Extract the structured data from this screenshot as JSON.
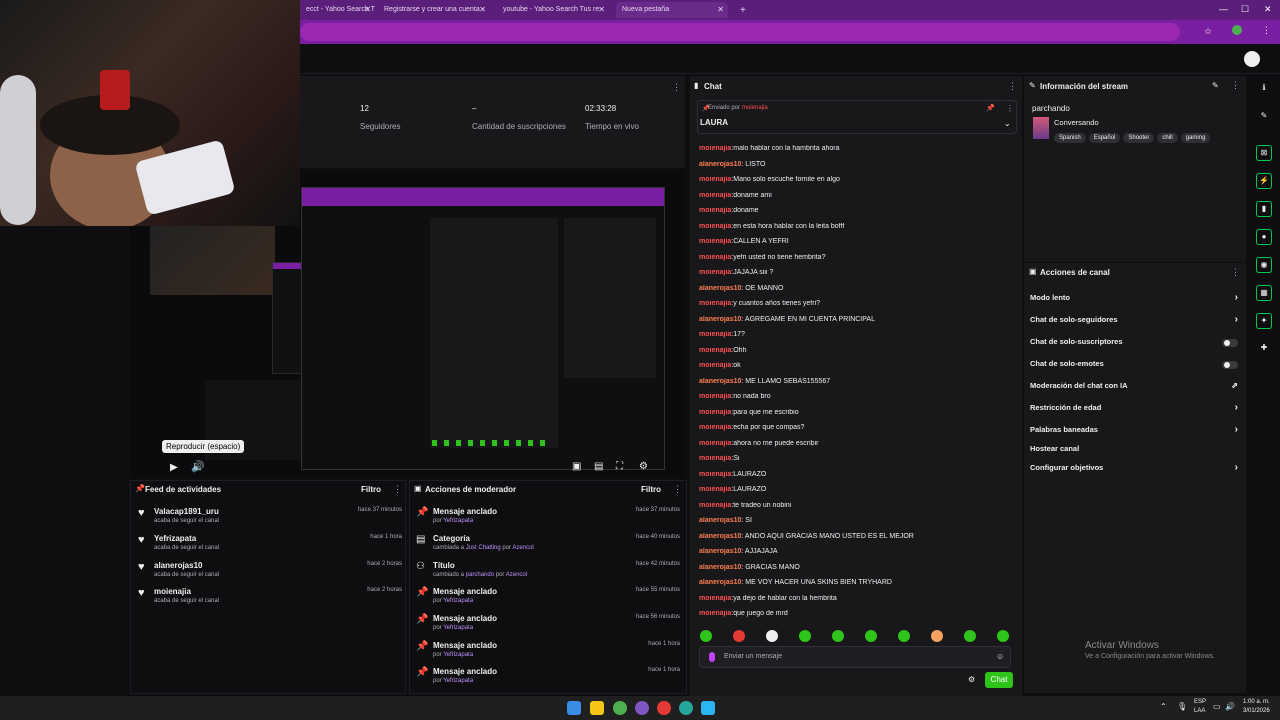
{
  "browser": {
    "tabs": [
      {
        "label": "ecct - Yahoo Search T"
      },
      {
        "label": "Registrarse y crear una cuenta"
      },
      {
        "label": "youtube - Yahoo Search Tus re"
      },
      {
        "label": "Nueva pestaña"
      }
    ],
    "new_tab": "+",
    "minimize": "—",
    "maximize": "☐",
    "close": "✕"
  },
  "stats": [
    {
      "value": "12",
      "label": "Seguidores"
    },
    {
      "value": "–",
      "label": "Cantidad de suscripciones"
    },
    {
      "value": "02:33:28",
      "label": "Tiempo en vivo"
    }
  ],
  "preview": {
    "tooltip": "Reproducir (espacio)"
  },
  "activity_feed": {
    "title": "Feed de actividades",
    "filter": "Filtro",
    "items": [
      {
        "name": "Valacap1891_uru",
        "sub": "acaba de seguir el canal",
        "time": "hace 37 minutos"
      },
      {
        "name": "Yefrizapata",
        "sub": "acaba de seguir el canal",
        "time": "hace 1 hora"
      },
      {
        "name": "alanerojas10",
        "sub": "acaba de seguir el canal",
        "time": "hace 2 horas"
      },
      {
        "name": "moienajia",
        "sub": "acaba de seguir el canal",
        "time": "hace 2 horas"
      }
    ]
  },
  "mod_actions": {
    "title": "Acciones de moderador",
    "filter": "Filtro",
    "items": [
      {
        "icon": "pin-icon",
        "name": "Mensaje anclado",
        "pre": "por ",
        "hl": "Yefrizapata",
        "mid": "",
        "hl2": "",
        "time": "hace 37 minutos"
      },
      {
        "icon": "category-icon",
        "name": "Categoría",
        "pre": "cambiada a ",
        "hl": "Just Chatting",
        "mid": " por ",
        "hl2": "Azencol",
        "time": "hace 40 minutos"
      },
      {
        "icon": "title-icon",
        "name": "Título",
        "pre": "cambiado a ",
        "hl": "parchando",
        "mid": " por ",
        "hl2": "Azencol",
        "time": "hace 42 minutos"
      },
      {
        "icon": "pin-icon",
        "name": "Mensaje anclado",
        "pre": "por ",
        "hl": "Yefrizapata",
        "mid": "",
        "hl2": "",
        "time": "hace 55 minutos"
      },
      {
        "icon": "pin-icon",
        "name": "Mensaje anclado",
        "pre": "por ",
        "hl": "Yefrizapata",
        "mid": "",
        "hl2": "",
        "time": "hace 56 minutos"
      },
      {
        "icon": "pin-icon",
        "name": "Mensaje anclado",
        "pre": "por ",
        "hl": "Yefrizapata",
        "mid": "",
        "hl2": "",
        "time": "hace 1 hora"
      },
      {
        "icon": "pin-icon",
        "name": "Mensaje anclado",
        "pre": "por ",
        "hl": "Yefrizapata",
        "mid": "",
        "hl2": "",
        "time": "hace 1 hora"
      }
    ]
  },
  "chat": {
    "title": "Chat",
    "pinned_by": "Enviado por",
    "pinned_user": "moienajia",
    "pinned_text": "LAURA",
    "messages": [
      {
        "user": "moienajia",
        "color": "#ff4f4f",
        "text": ":malo hablar con la hambrita ahora"
      },
      {
        "user": "alanerojas10",
        "color": "#ff7f50",
        "text": ": LISTO"
      },
      {
        "user": "moienajia",
        "color": "#ff4f4f",
        "text": ":Mano solo escuche fornite en algo"
      },
      {
        "user": "moienajia",
        "color": "#ff4f4f",
        "text": ":doname ami"
      },
      {
        "user": "moienajia",
        "color": "#ff4f4f",
        "text": ":doname"
      },
      {
        "user": "moienajia",
        "color": "#ff4f4f",
        "text": ":en esta hora hablar con la leita bofff"
      },
      {
        "user": "moienajia",
        "color": "#ff4f4f",
        "text": ":CALLEN A YEFRI"
      },
      {
        "user": "moienajia",
        "color": "#ff4f4f",
        "text": ":yefri usted no tiene hembrita?"
      },
      {
        "user": "moienajia",
        "color": "#ff4f4f",
        "text": ":JAJAJA siii ?"
      },
      {
        "user": "alanerojas10",
        "color": "#ff7f50",
        "text": ": OE MANNO"
      },
      {
        "user": "moienajia",
        "color": "#ff4f4f",
        "text": ":y cuantos años tienes yefri?"
      },
      {
        "user": "alanerojas10",
        "color": "#ff7f50",
        "text": ": AGREGAME EN MI CUENTA PRINCIPAL"
      },
      {
        "user": "moienajia",
        "color": "#ff4f4f",
        "text": ":17?"
      },
      {
        "user": "moienajia",
        "color": "#ff4f4f",
        "text": ":Ohh"
      },
      {
        "user": "moienajia",
        "color": "#ff4f4f",
        "text": ":ok"
      },
      {
        "user": "alanerojas10",
        "color": "#ff7f50",
        "text": ": ME LLAMO SEBAS155567"
      },
      {
        "user": "moienajia",
        "color": "#ff4f4f",
        "text": ":no nada bro"
      },
      {
        "user": "moienajia",
        "color": "#ff4f4f",
        "text": ":para que me escribio"
      },
      {
        "user": "moienajia",
        "color": "#ff4f4f",
        "text": ":echa por que compas?"
      },
      {
        "user": "moienajia",
        "color": "#ff4f4f",
        "text": ":ahora no me puede escribir"
      },
      {
        "user": "moienajia",
        "color": "#ff4f4f",
        "text": ":Si"
      },
      {
        "user": "moienajia",
        "color": "#ff4f4f",
        "text": ":LAURAZO"
      },
      {
        "user": "moienajia",
        "color": "#ff4f4f",
        "text": ":LAURAZO"
      },
      {
        "user": "moienajia",
        "color": "#ff4f4f",
        "text": ":te tradeo un nobini"
      },
      {
        "user": "alanerojas10",
        "color": "#ff7f50",
        "text": ": SI"
      },
      {
        "user": "alanerojas10",
        "color": "#ff7f50",
        "text": ": ANDO AQUI GRACIAS MANO USTED ES EL MEJOR"
      },
      {
        "user": "alanerojas10",
        "color": "#ff7f50",
        "text": ": AJJAJAJA"
      },
      {
        "user": "alanerojas10",
        "color": "#ff7f50",
        "text": ": GRACIAS MANO"
      },
      {
        "user": "alanerojas10",
        "color": "#ff7f50",
        "text": ": ME VOY HACER UNA SKINS BIEN TRYHARD"
      },
      {
        "user": "moienajia",
        "color": "#ff4f4f",
        "text": ":ya dejo de hablar con la hembrita"
      },
      {
        "user": "moienajia",
        "color": "#ff4f4f",
        "text": ":que juego de mrd"
      }
    ],
    "input_placeholder": "Enviar un mensaje",
    "send_label": "Chat"
  },
  "stream_info": {
    "title": "Información del stream",
    "stream_title": "parchando",
    "category": "Conversando",
    "tags": [
      "Spanish",
      "Español",
      "Shooter",
      "chill",
      "gaming"
    ]
  },
  "channel_actions": {
    "title": "Acciones de canal",
    "rows": [
      {
        "label": "Modo lento",
        "control": "chevron"
      },
      {
        "label": "Chat de solo-seguidores",
        "control": "chevron"
      },
      {
        "label": "Chat de solo-suscriptores",
        "control": "toggle"
      },
      {
        "label": "Chat de solo-emotes",
        "control": "toggle"
      },
      {
        "label": "Moderación del chat con IA",
        "control": "ext"
      },
      {
        "label": "Restricción de edad",
        "control": "chevron"
      },
      {
        "label": "Palabras baneadas",
        "control": "chevron"
      },
      {
        "label": "Hostear canal",
        "control": "none"
      },
      {
        "label": "Configurar objetivos",
        "control": "chevron"
      }
    ]
  },
  "watermark": {
    "title": "Activar Windows",
    "sub": "Ve a Configuración para activar Windows."
  },
  "taskbar": {
    "lang": "ESP",
    "lang2": "LAA",
    "time": "1:00 a. m.",
    "date": "3/01/2026"
  },
  "colors": {
    "accent": "#9147ff",
    "chrome_purple": "#7b1fa2",
    "chat_send_green": "#2ec41a",
    "side_icon_green": "#00c853"
  }
}
